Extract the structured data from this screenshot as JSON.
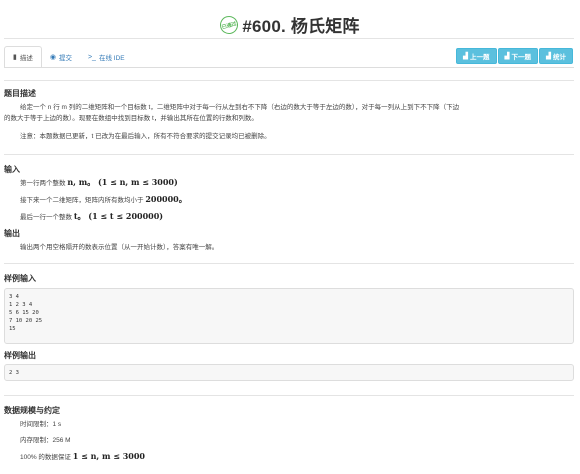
{
  "header": {
    "badge_text": "已通过",
    "title": "#600. 杨氏矩阵"
  },
  "tabs": [
    {
      "label": "描述",
      "icon": "book-icon"
    },
    {
      "label": "提交",
      "icon": "circle-dot-icon"
    },
    {
      "label": "在线 IDE",
      "icon": "terminal-icon"
    }
  ],
  "buttons": {
    "prev": "上一题",
    "next": "下一题",
    "stats": "统计"
  },
  "description": {
    "heading": "题目描述",
    "line1": "给定一个 n 行 m 列的二维矩阵和一个目标数 t，二维矩阵中对于每一行从左到右不下降（右边的数大于等于左边的数），对于每一列从上到下不下降（下边",
    "line2": "的数大于等于上边的数）。现要在数组中找到目标数 t，并输出其所在位置的行数和列数。",
    "note": "注意：本题数据已更新，t 已改为在最后输入，所有不符合要求的提交记录均已被删除。"
  },
  "input": {
    "heading": "输入",
    "line1_pre": "第一行两个整数",
    "line1_math": "n, m。 (1 ≤ n, m ≤ 3000)",
    "line2_pre": "接下来一个二维矩阵，矩阵内所有数均小于",
    "line2_math": "200000。",
    "line3_pre": "最后一行一个整数",
    "line3_math": "t。 (1 ≤ t ≤ 200000)"
  },
  "output": {
    "heading": "输出",
    "line1": "输出两个用空格隔开的数表示位置（从一开始计数），答案有唯一解。"
  },
  "sample_input": {
    "heading": "样例输入",
    "content": "3 4\n1 2 3 4\n5 6 15 20\n7 10 20 25\n15"
  },
  "sample_output": {
    "heading": "样例输出",
    "content": "2 3"
  },
  "limits": {
    "heading": "数据规模与约定",
    "time": "时间限制：1 s",
    "memory": "内存限制：256 M",
    "guarantee_pre": "100% 的数据保证",
    "guarantee_math": "1 ≤ n, m ≤ 3000"
  }
}
